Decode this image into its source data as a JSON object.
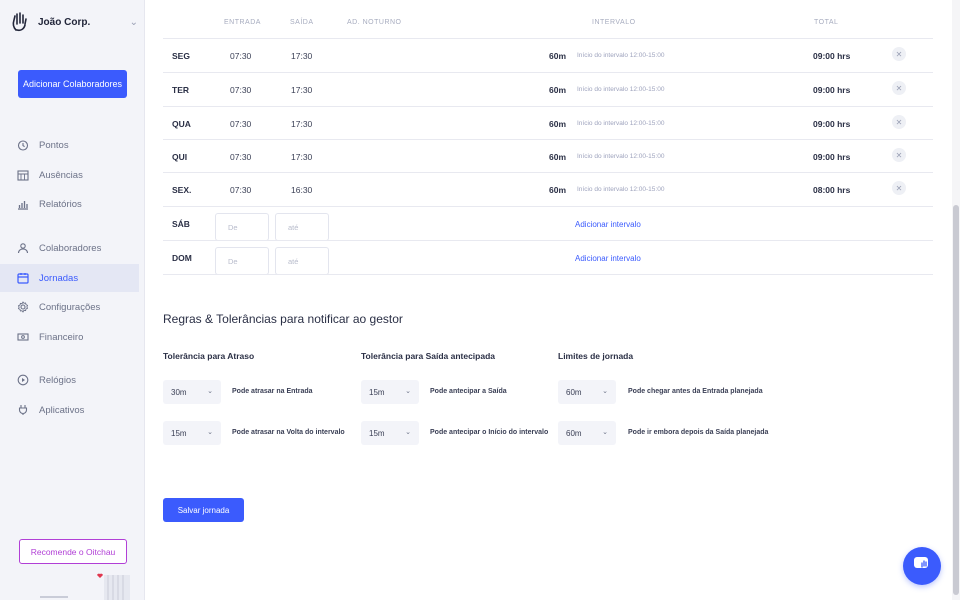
{
  "brand": {
    "name": "João Corp."
  },
  "sidebar": {
    "add_button": "Adicionar Colaboradores",
    "items": [
      {
        "label": "Pontos",
        "icon": "clock-icon"
      },
      {
        "label": "Ausências",
        "icon": "calendar-grid-icon"
      },
      {
        "label": "Relatórios",
        "icon": "chart-icon"
      },
      {
        "label": "Colaboradores",
        "icon": "users-icon"
      },
      {
        "label": "Jornadas",
        "icon": "calendar-icon",
        "active": true
      },
      {
        "label": "Configurações",
        "icon": "gear-icon"
      },
      {
        "label": "Financeiro",
        "icon": "money-icon"
      },
      {
        "label": "Relógios",
        "icon": "play-circle-icon"
      },
      {
        "label": "Aplicativos",
        "icon": "plug-icon"
      }
    ],
    "recommend": "Recomende o Oitchau"
  },
  "schedule": {
    "headers": {
      "entrada": "ENTRADA",
      "saida": "SAÍDA",
      "noturno": "AD. NOTURNO",
      "intervalo": "INTERVALO",
      "total": "TOTAL"
    },
    "rows": [
      {
        "day": "SEG",
        "entrada": "07:30",
        "saida": "17:30",
        "intervalo": "60m",
        "intervalo_desc": "Início do intervalo 12:00-15:00",
        "total": "09:00 hrs"
      },
      {
        "day": "TER",
        "entrada": "07:30",
        "saida": "17:30",
        "intervalo": "60m",
        "intervalo_desc": "Início do intervalo 12:00-15:00",
        "total": "09:00 hrs"
      },
      {
        "day": "QUA",
        "entrada": "07:30",
        "saida": "17:30",
        "intervalo": "60m",
        "intervalo_desc": "Início do intervalo 12:00-15:00",
        "total": "09:00 hrs"
      },
      {
        "day": "QUI",
        "entrada": "07:30",
        "saida": "17:30",
        "intervalo": "60m",
        "intervalo_desc": "Início do intervalo 12:00-15:00",
        "total": "09:00 hrs"
      },
      {
        "day": "SEX.",
        "entrada": "07:30",
        "saida": "16:30",
        "intervalo": "60m",
        "intervalo_desc": "Início do intervalo 12:00-15:00",
        "total": "08:00 hrs"
      }
    ],
    "empty_rows": [
      {
        "day": "SÁB",
        "from_placeholder": "De",
        "to_placeholder": "até",
        "add_interval": "Adicionar intervalo"
      },
      {
        "day": "DOM",
        "from_placeholder": "De",
        "to_placeholder": "até",
        "add_interval": "Adicionar intervalo"
      }
    ]
  },
  "rules": {
    "title": "Regras & Tolerâncias para notificar ao gestor",
    "groups": [
      {
        "heading": "Tolerância para Atraso",
        "items": [
          {
            "value": "30m",
            "text": "Pode atrasar na Entrada"
          },
          {
            "value": "15m",
            "text": "Pode atrasar na Volta do intervalo"
          }
        ]
      },
      {
        "heading": "Tolerância para Saída antecipada",
        "items": [
          {
            "value": "15m",
            "text": "Pode antecipar a Saída"
          },
          {
            "value": "15m",
            "text": "Pode antecipar o Início do intervalo"
          }
        ]
      },
      {
        "heading": "Limites de jornada",
        "items": [
          {
            "value": "60m",
            "text": "Pode chegar antes da Entrada planejada"
          },
          {
            "value": "60m",
            "text": "Pode ir embora depois da Saída planejada"
          }
        ]
      }
    ]
  },
  "save_button": "Salvar jornada",
  "colors": {
    "accent": "#3b5bfd",
    "recommend": "#b13fd6"
  }
}
